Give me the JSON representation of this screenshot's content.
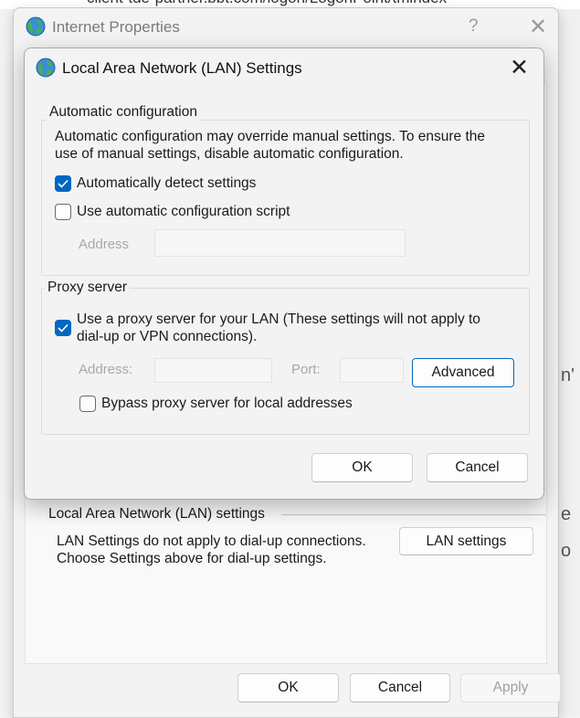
{
  "background": {
    "url_fragment": "client-tde-partner.bbt.com/logon/LogonPoint/tmindex",
    "right_chars": [
      "n'",
      "e",
      "o"
    ]
  },
  "internet_properties": {
    "title": "Internet Properties",
    "help_label": "?",
    "close_label": "✕",
    "lan_section": {
      "legend": "Local Area Network (LAN) settings",
      "description": "LAN Settings do not apply to dial-up connections.\nChoose Settings above for dial-up settings.",
      "lan_settings_button": "LAN settings"
    },
    "footer": {
      "ok": "OK",
      "cancel": "Cancel",
      "apply": "Apply"
    }
  },
  "lan_dialog": {
    "title": "Local Area Network (LAN) Settings",
    "close_label": "✕",
    "automatic": {
      "legend": "Automatic configuration",
      "description": "Automatic configuration may override manual settings.  To ensure the\nuse of manual settings, disable automatic configuration.",
      "detect_label": "Automatically detect settings",
      "detect_checked": true,
      "script_label": "Use automatic configuration script",
      "script_checked": false,
      "address_label": "Address",
      "address_value": ""
    },
    "proxy": {
      "legend": "Proxy server",
      "use_proxy_label": "Use a proxy server for your LAN (These settings will not apply to\ndial-up or VPN connections).",
      "use_proxy_checked": true,
      "address_label": "Address:",
      "address_value": "",
      "port_label": "Port:",
      "port_value": "",
      "advanced_button": "Advanced",
      "bypass_label": "Bypass proxy server for local addresses",
      "bypass_checked": false
    },
    "ok": "OK",
    "cancel": "Cancel"
  },
  "colors": {
    "accent": "#0067c0",
    "disabled_text": "#a8a8a8"
  }
}
